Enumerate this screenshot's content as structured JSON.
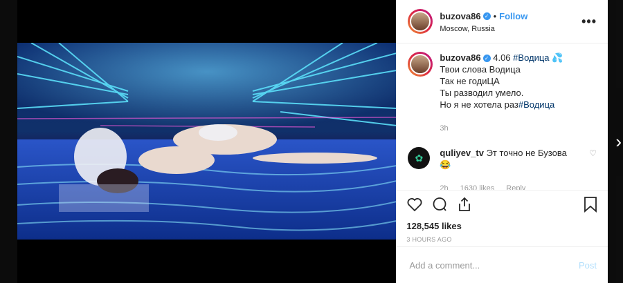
{
  "post": {
    "username": "buzova86",
    "location": "Moscow, Russia",
    "follow_label": "Follow",
    "separator": "•",
    "verified_icon": "verified-badge-icon",
    "more_glyph": "•••"
  },
  "caption": {
    "username": "buzova86",
    "date": "4.06",
    "hashtag": "#Водица",
    "emoji": "droplet-emoji",
    "lines": [
      "Твои слова Водица",
      "Так не годиЦА",
      "Ты разводил умело.",
      "Но я не хотела раз"
    ],
    "end_hashtag": "#Водица",
    "time": "3h"
  },
  "comment": {
    "username": "quliyev_tv",
    "text": "Эт точно не Бузова",
    "emoji": "😂",
    "time": "2h",
    "likes": "1630 likes",
    "reply": "Reply"
  },
  "engagement": {
    "likes": "128,545 likes",
    "posted": "3 HOURS AGO"
  },
  "add_comment": {
    "placeholder": "Add a comment...",
    "post_label": "Post"
  },
  "colors": {
    "accent": "#3897f0",
    "hashtag": "#003569",
    "muted": "#999999"
  }
}
